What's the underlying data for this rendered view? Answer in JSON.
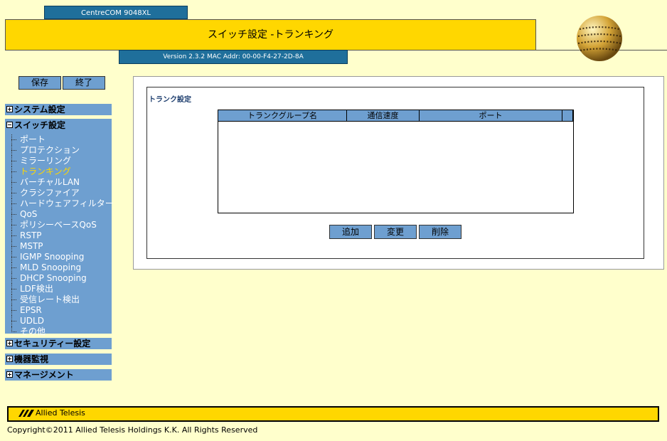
{
  "header": {
    "model": "CentreCOM 9048XL",
    "title": "スイッチ設定 -トランキング",
    "version": "Version 2.3.2 MAC Addr: 00-00-F4-27-2D-8A"
  },
  "toolbar": {
    "save_label": "保存",
    "exit_label": "終了"
  },
  "nav": {
    "system": "システム設定",
    "switch": "スイッチ設定",
    "switch_items": [
      "ポート",
      "プロテクション",
      "ミラーリング",
      "トランキング",
      "バーチャルLAN",
      "クラシファイア",
      "ハードウェアフィルター",
      "QoS",
      "ポリシーベースQoS",
      "RSTP",
      "MSTP",
      "IGMP Snooping",
      "MLD Snooping",
      "DHCP Snooping",
      "LDF検出",
      "受信レート検出",
      "EPSR",
      "UDLD",
      "その他"
    ],
    "active_item": "トランキング",
    "security": "セキュリティー設定",
    "monitor": "機器監視",
    "management": "マネージメント"
  },
  "main": {
    "section_title": "トランク設定",
    "table_headers": [
      "トランクグループ名",
      "通信速度",
      "ポート"
    ],
    "buttons": {
      "add": "追加",
      "change": "変更",
      "delete": "削除"
    }
  },
  "footer": {
    "logo": "Allied Telesis",
    "copyright": "Copyright©2011 Allied Telesis Holdings K.K. All Rights Reserved"
  },
  "colors": {
    "accent_yellow": "#ffd700",
    "nav_blue": "#6e9fd0",
    "header_blue": "#1f6f9b",
    "background": "#ffffcc"
  }
}
